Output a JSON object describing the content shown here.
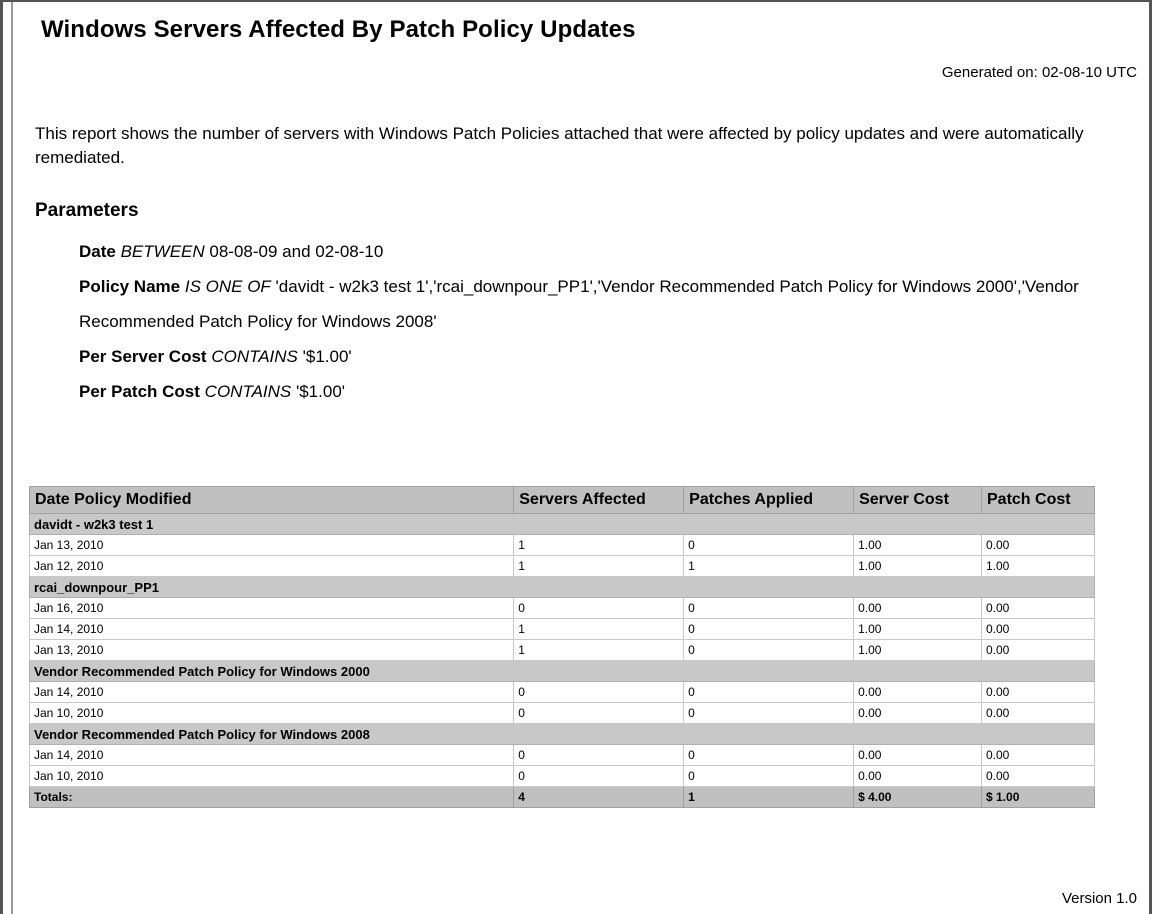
{
  "report": {
    "title": "Windows Servers Affected By Patch Policy Updates",
    "generated": "Generated on: 02-08-10 UTC",
    "description": "This report shows the number of servers with Windows Patch Policies attached that were affected by policy updates and were automatically remediated.",
    "version": "Version 1.0"
  },
  "parameters": {
    "heading": "Parameters",
    "items": [
      {
        "name": "Date",
        "op": "BETWEEN",
        "value": "08-08-09 and 02-08-10"
      },
      {
        "name": "Policy Name",
        "op": "IS ONE OF",
        "value": "'davidt - w2k3 test 1','rcai_downpour_PP1','Vendor Recommended Patch Policy for Windows 2000','Vendor Recommended Patch Policy for Windows 2008'"
      },
      {
        "name": "Per Server Cost",
        "op": "CONTAINS",
        "value": "'$1.00'"
      },
      {
        "name": "Per Patch Cost",
        "op": "CONTAINS",
        "value": "'$1.00'"
      }
    ]
  },
  "table": {
    "headers": [
      "Date Policy Modified",
      "Servers Affected",
      "Patches Applied",
      "Server Cost",
      "Patch Cost"
    ],
    "groups": [
      {
        "name": "davidt - w2k3 test 1",
        "rows": [
          [
            "Jan 13, 2010",
            "1",
            "0",
            "1.00",
            "0.00"
          ],
          [
            "Jan 12, 2010",
            "1",
            "1",
            "1.00",
            "1.00"
          ]
        ]
      },
      {
        "name": "rcai_downpour_PP1",
        "rows": [
          [
            "Jan 16, 2010",
            "0",
            "0",
            "0.00",
            "0.00"
          ],
          [
            "Jan 14, 2010",
            "1",
            "0",
            "1.00",
            "0.00"
          ],
          [
            "Jan 13, 2010",
            "1",
            "0",
            "1.00",
            "0.00"
          ]
        ]
      },
      {
        "name": "Vendor Recommended Patch Policy for Windows 2000",
        "rows": [
          [
            "Jan 14, 2010",
            "0",
            "0",
            "0.00",
            "0.00"
          ],
          [
            "Jan 10, 2010",
            "0",
            "0",
            "0.00",
            "0.00"
          ]
        ]
      },
      {
        "name": "Vendor Recommended Patch Policy for Windows 2008",
        "rows": [
          [
            "Jan 14, 2010",
            "0",
            "0",
            "0.00",
            "0.00"
          ],
          [
            "Jan 10, 2010",
            "0",
            "0",
            "0.00",
            "0.00"
          ]
        ]
      }
    ],
    "totals": [
      "Totals:",
      "4",
      "1",
      "$ 4.00",
      "$ 1.00"
    ]
  }
}
